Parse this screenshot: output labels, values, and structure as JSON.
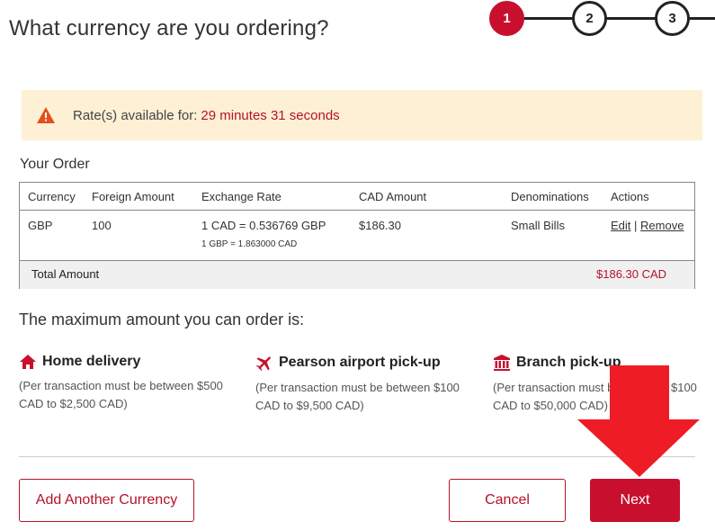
{
  "header": {
    "title": "What currency are you ordering?",
    "steps": [
      "1",
      "2",
      "3"
    ],
    "active_step": 1
  },
  "alert": {
    "text": "Rate(s) available for:",
    "time": "29 minutes 31 seconds",
    "icon": "warning-icon"
  },
  "order": {
    "label": "Your Order",
    "columns": [
      "Currency",
      "Foreign Amount",
      "Exchange Rate",
      "CAD Amount",
      "Denominations",
      "Actions"
    ],
    "rows": [
      {
        "currency": "GBP",
        "foreign_amount": "100",
        "exchange_rate": "1 CAD = 0.536769 GBP",
        "exchange_rate_inverse": "1 GBP = 1.863000 CAD",
        "cad_amount": "$186.30",
        "denominations": "Small Bills",
        "edit_label": "Edit",
        "separator": "|",
        "remove_label": "Remove"
      }
    ],
    "total_label": "Total Amount",
    "total_value": "$186.30 CAD"
  },
  "maximum": {
    "label": "The maximum amount you can order is:",
    "options": [
      {
        "title": "Home delivery",
        "icon": "home-icon",
        "line1": "(Per transaction must be between $500",
        "line2": "CAD to $2,500 CAD)"
      },
      {
        "title": "Pearson airport pick-up",
        "icon": "airplane-icon",
        "line1": "(Per transaction must be between $100",
        "line2": "CAD to $9,500 CAD)"
      },
      {
        "title": "Branch pick-up",
        "icon": "bank-icon",
        "line1": "(Per transaction must be between $100",
        "line2": "CAD to $50,000 CAD)"
      }
    ]
  },
  "buttons": {
    "add_currency": "Add Another Currency",
    "cancel": "Cancel",
    "next": "Next"
  },
  "colors": {
    "brand_red": "#c8102e",
    "alert_bg": "#fdf0d5",
    "alert_icon": "#e0521d",
    "annotation_arrow": "#ee1c25"
  }
}
